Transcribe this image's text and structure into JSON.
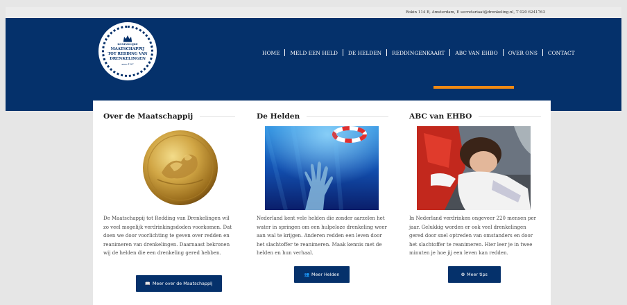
{
  "topbar": {
    "contact_line": "Rokin 114 B, Amsterdam, E secretariaat@drenkeling.nl, T 020 6241763"
  },
  "logo": {
    "line1": "KONINKLIJKE",
    "line2": "MAATSCHAPPIJ",
    "line3": "TOT REDDING VAN",
    "line4": "DRENKELINGEN",
    "line5": "anno 1767"
  },
  "nav": {
    "items": [
      {
        "label": "HOME"
      },
      {
        "label": "MELD EEN HELD"
      },
      {
        "label": "DE HELDEN"
      },
      {
        "label": "REDDINGENKAART"
      },
      {
        "label": "ABC VAN EHBO"
      },
      {
        "label": "OVER ONS"
      },
      {
        "label": "CONTACT"
      }
    ],
    "active_color": "#f08a13"
  },
  "colors": {
    "brand": "#05316b",
    "accent": "#f08a13",
    "page_bg": "#e6e6e6"
  },
  "columns": [
    {
      "title": "Over de Maatschappij",
      "image_icon": "gold-medal-image",
      "text": "De Maatschappij tot Redding van Drenkelingen wil zo veel mogelijk verdrinkingsdoden voorkomen. Dat doen we door voorlichting te geven over redden en reanimeren van drenkelingen. Daarnaast bekronen wij de helden die een drenkeling gered hebben.",
      "button_label": "Meer over de Maatschappij",
      "button_icon": "book-icon"
    },
    {
      "title": "De Helden",
      "image_icon": "drowning-hand-image",
      "text": "Nederland kent vele helden die zonder aarzelen het water in springen om een hulpeloze drenkeling weer aan wal te krijgen. Anderen redden een leven door het slachtoffer te reanimeren. Maak kennis met de helden en hun verhaal.",
      "button_label": "Meer Helden",
      "button_icon": "users-icon"
    },
    {
      "title": "ABC van EHBO",
      "image_icon": "first-aid-image",
      "text": "In Nederland verdrinken ongeveer 220 mensen per jaar. Gelukkig worden er ook veel drenkelingen gered door snel optreden van omstanders en door het slachtoffer te reanimeren. Hier leer je in twee minuten je hoe jij een leven kan redden.",
      "button_label": "Meer tips",
      "button_icon": "lifebuoy-icon"
    }
  ]
}
